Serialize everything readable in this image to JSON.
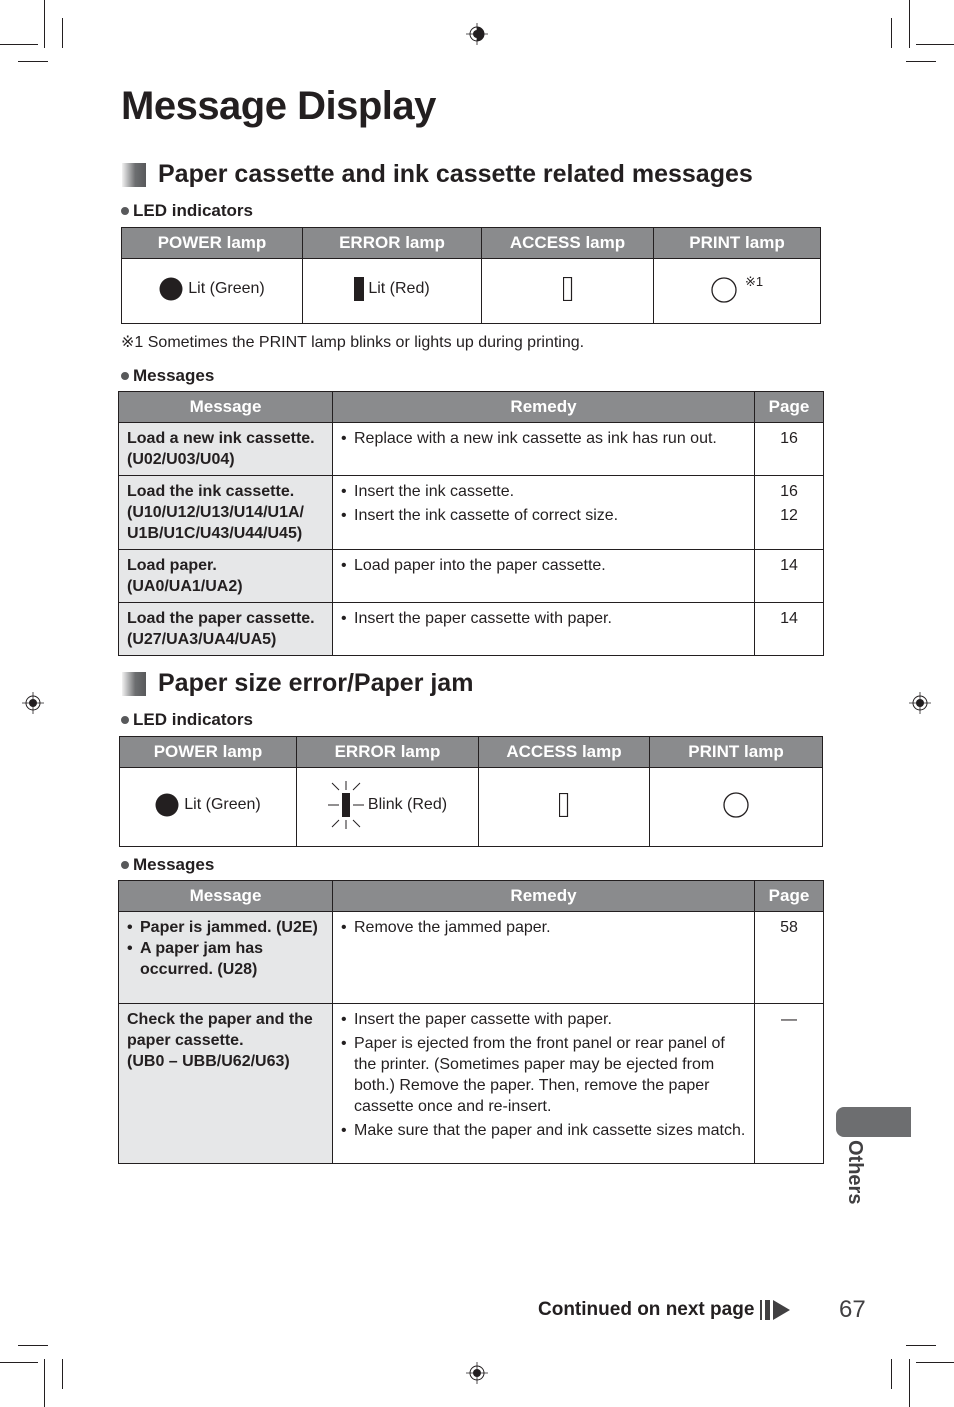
{
  "page_title": "Message Display",
  "sections": [
    {
      "title": "Paper cassette and ink cassette related messages",
      "led_label": "LED indicators",
      "led_headers": [
        "POWER lamp",
        "ERROR lamp",
        "ACCESS lamp",
        "PRINT lamp"
      ],
      "led_states": {
        "power": "Lit (Green)",
        "error": "Lit (Red)",
        "access": "",
        "print": "",
        "print_mark": "※1"
      },
      "footnote": "※1 Sometimes the PRINT lamp blinks or lights up during printing.",
      "messages_label": "Messages",
      "msg_headers": [
        "Message",
        "Remedy",
        "Page"
      ],
      "rows": [
        {
          "message": [
            "Load a new ink cassette.",
            "(U02/U03/U04)"
          ],
          "remedy": [
            "Replace with a new ink cassette as ink has run out."
          ],
          "pages": [
            "16"
          ]
        },
        {
          "message": [
            "Load the ink cassette.",
            "(U10/U12/U13/U14/U1A/",
            "U1B/U1C/U43/U44/U45)"
          ],
          "remedy": [
            "Insert the ink cassette.",
            "Insert the ink cassette of correct size."
          ],
          "pages": [
            "16",
            "12"
          ]
        },
        {
          "message": [
            "Load paper.",
            "(UA0/UA1/UA2)"
          ],
          "remedy": [
            "Load paper into the paper cassette."
          ],
          "pages": [
            "14"
          ]
        },
        {
          "message": [
            "Load the paper cassette.",
            "(U27/UA3/UA4/UA5)"
          ],
          "remedy": [
            "Insert the paper cassette with paper."
          ],
          "pages": [
            "14"
          ]
        }
      ]
    },
    {
      "title": "Paper size error/Paper jam",
      "led_label": "LED indicators",
      "led_headers": [
        "POWER lamp",
        "ERROR lamp",
        "ACCESS lamp",
        "PRINT lamp"
      ],
      "led_states": {
        "power": "Lit (Green)",
        "error": "Blink (Red)",
        "access": "",
        "print": ""
      },
      "messages_label": "Messages",
      "msg_headers": [
        "Message",
        "Remedy",
        "Page"
      ],
      "rows": [
        {
          "message_bullets": [
            "Paper is jammed. (U2E)",
            "A paper jam has occurred. (U28)"
          ],
          "remedy": [
            "Remove the jammed paper."
          ],
          "pages": [
            "58"
          ]
        },
        {
          "message": [
            "Check the paper and the paper cassette.",
            "(UB0 – UBB/U62/U63)"
          ],
          "remedy": [
            "Insert the paper cassette with paper.",
            "Paper is ejected from the front panel or rear panel of the printer. (Sometimes paper may be ejected from both.) Remove the paper. Then, remove the paper cassette once and re-insert.",
            "Make sure that the paper and ink cassette sizes match."
          ],
          "pages": [
            "—"
          ]
        }
      ]
    }
  ],
  "side_tab": "Others",
  "continued": "Continued on next page",
  "page_number": "67"
}
